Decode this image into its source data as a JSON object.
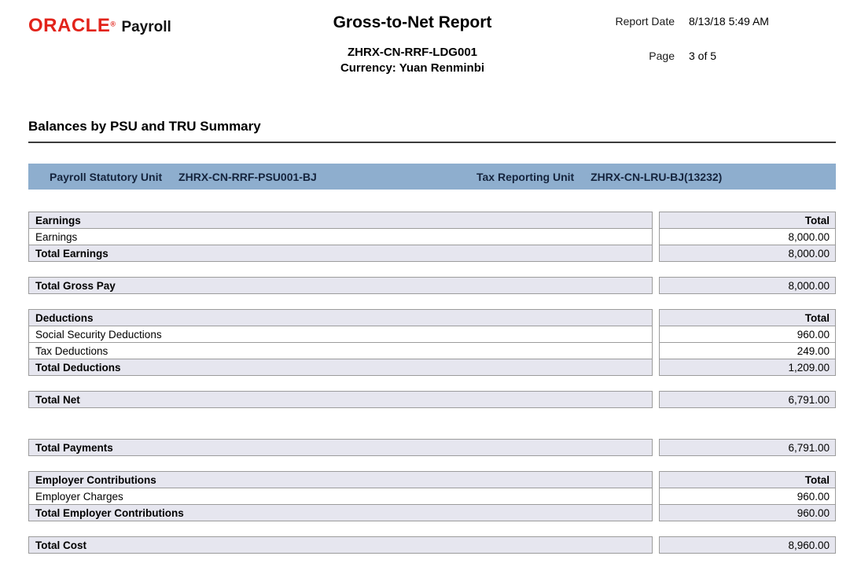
{
  "header": {
    "brand_oracle": "ORACLE",
    "brand_reg": "®",
    "brand_product": "Payroll",
    "title": "Gross-to-Net Report",
    "subtitle": "ZHRX-CN-RRF-LDG001",
    "currency_line": "Currency: Yuan Renminbi",
    "report_date_label": "Report Date",
    "report_date_value": "8/13/18 5:49 AM",
    "page_label": "Page",
    "page_value": "3 of 5"
  },
  "section_title": "Balances by PSU and TRU Summary",
  "unit_bar": {
    "psu_label": "Payroll Statutory Unit",
    "psu_value": "ZHRX-CN-RRF-PSU001-BJ",
    "tru_label": "Tax Reporting Unit",
    "tru_value": "ZHRX-CN-LRU-BJ(13232)"
  },
  "colors": {
    "oracle_red": "#e2231a",
    "bar_blue": "#8eaece",
    "bar_text": "#15243d",
    "row_shade": "#e6e6ef",
    "border_gray": "#9c9c9c",
    "rule_gray": "#3c3c3c"
  },
  "blocks": [
    {
      "name": "earnings",
      "rows": [
        {
          "label": "Earnings",
          "value": "Total",
          "type": "header"
        },
        {
          "label": "Earnings",
          "value": "8,000.00",
          "type": "normal"
        },
        {
          "label": "Total Earnings",
          "value": "8,000.00",
          "type": "total"
        }
      ]
    },
    {
      "name": "total-gross-pay",
      "rows": [
        {
          "label": "Total Gross Pay",
          "value": "8,000.00",
          "type": "total"
        }
      ]
    },
    {
      "name": "deductions",
      "rows": [
        {
          "label": "Deductions",
          "value": "Total",
          "type": "header"
        },
        {
          "label": "Social Security Deductions",
          "value": "960.00",
          "type": "normal"
        },
        {
          "label": "Tax Deductions",
          "value": "249.00",
          "type": "normal"
        },
        {
          "label": "Total Deductions",
          "value": "1,209.00",
          "type": "total"
        }
      ]
    },
    {
      "name": "total-net",
      "rows": [
        {
          "label": "Total Net",
          "value": "6,791.00",
          "type": "total"
        }
      ]
    },
    {
      "name": "total-payments",
      "rows": [
        {
          "label": "Total Payments",
          "value": "6,791.00",
          "type": "total"
        }
      ]
    },
    {
      "name": "employer-contributions",
      "rows": [
        {
          "label": "Employer Contributions",
          "value": "Total",
          "type": "header"
        },
        {
          "label": "Employer Charges",
          "value": "960.00",
          "type": "normal"
        },
        {
          "label": "Total Employer Contributions",
          "value": "960.00",
          "type": "total"
        }
      ]
    },
    {
      "name": "total-cost",
      "rows": [
        {
          "label": "Total Cost",
          "value": "8,960.00",
          "type": "total"
        }
      ]
    }
  ]
}
